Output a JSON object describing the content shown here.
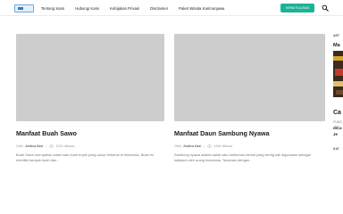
{
  "header": {
    "nav": [
      "Tentang Kami",
      "Hubungi Kami",
      "Kebijakan Privasi",
      "Disclaimer",
      "Paket Wisata Karimunjawa"
    ],
    "cta_label": "KIRIM TULISAN"
  },
  "posts": [
    {
      "title": "Manfaat Buah Sawo",
      "by_label": "Oleh",
      "author": "Andica Akzi",
      "views": "122x dibaca",
      "excerpt": "Buah Sawo merupakan salah satu buah tropis yang cukup terkenal di Indonesia. Buah ini memiliki tampak buah dan..."
    },
    {
      "title": "Manfaat Daun Sambung Nyawa",
      "by_label": "Oleh",
      "author": "Andica Akzi",
      "views": "448x dibaca",
      "excerpt": "Sambung nyawa adalah salah satu tumbuhan herbal yang sering kali digunakan sebagai kalepani oleh orang Indonesia. Tanaman dengan..."
    }
  ],
  "sidebar": {
    "label_top": "ART",
    "title_fragment": "Ma",
    "big_fragment": "Ca",
    "small_fragment": "PUBO",
    "line1": "diCa",
    "line2": "Je",
    "label_bottom": "KAT"
  },
  "colors": {
    "accent": "#1ab394",
    "thumb": "#cdcdcd"
  },
  "icons": {
    "search": "search-icon",
    "views": "eye-icon"
  }
}
